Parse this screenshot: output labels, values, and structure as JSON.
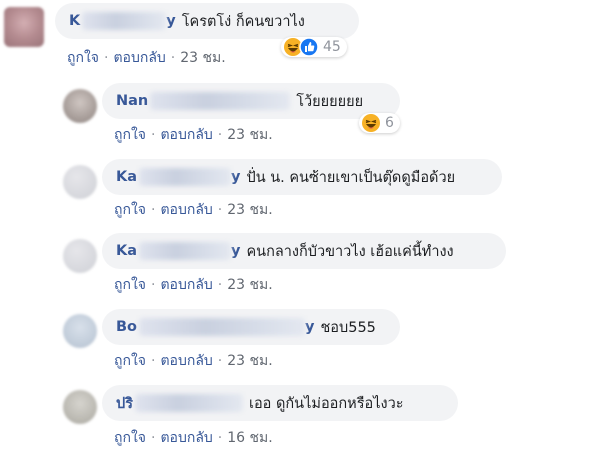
{
  "comments": [
    {
      "author_visible": "K",
      "author_tail": "y",
      "text": "โครตโง่ ก็คนขวาไง",
      "actions": {
        "like": "ถูกใจ",
        "reply": "ตอบกลับ",
        "time": "23 ชม."
      },
      "reactions": {
        "icons": [
          "haha-icon",
          "like-icon"
        ],
        "count": "45"
      }
    },
    {
      "author_visible": "Nan",
      "author_tail": "",
      "text": "โว้ยยยยยย",
      "actions": {
        "like": "ถูกใจ",
        "reply": "ตอบกลับ",
        "time": "23 ชม."
      },
      "reactions": {
        "icons": [
          "haha-icon"
        ],
        "count": "6"
      }
    },
    {
      "author_visible": "Ka",
      "author_tail": "y",
      "text": "ปั่น น. คนซ้ายเขาเป็นตุ๊ดดูมือด้วย",
      "actions": {
        "like": "ถูกใจ",
        "reply": "ตอบกลับ",
        "time": "23 ชม."
      }
    },
    {
      "author_visible": "Ka",
      "author_tail": "y",
      "text": "คนกลางก็บัวขาวไง เฮ้อแค่นี้ทำงง",
      "actions": {
        "like": "ถูกใจ",
        "reply": "ตอบกลับ",
        "time": "23 ชม."
      }
    },
    {
      "author_visible": "Bo",
      "author_tail": "y",
      "text": "ชอบ555",
      "actions": {
        "like": "ถูกใจ",
        "reply": "ตอบกลับ",
        "time": "23 ชม."
      }
    },
    {
      "author_visible": "ปริ",
      "author_tail": "",
      "text": "เออ ดูกันไม่ออกหรือไงวะ",
      "actions": {
        "like": "ถูกใจ",
        "reply": "ตอบกลับ",
        "time": "16 ชม."
      }
    }
  ],
  "colors": {
    "author": "#385898",
    "bubble": "#f2f3f5",
    "meta": "#616770",
    "haha": "#f7b125",
    "like": "#1877f2"
  }
}
